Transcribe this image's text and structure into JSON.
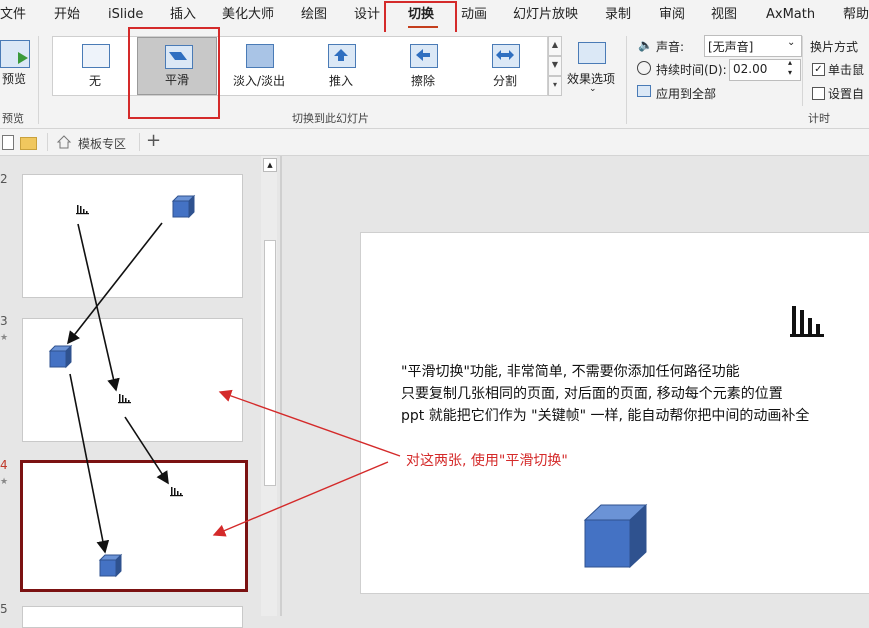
{
  "ribbon_tabs": [
    "文件",
    "开始",
    "iSlide",
    "插入",
    "美化大师",
    "绘图",
    "设计",
    "切换",
    "动画",
    "幻灯片放映",
    "录制",
    "审阅",
    "视图",
    "AxMath",
    "帮助"
  ],
  "active_tab": "切换",
  "preview": {
    "label": "预览",
    "group": "预览"
  },
  "transitions": [
    "无",
    "平滑",
    "淡入/淡出",
    "推入",
    "擦除",
    "分割"
  ],
  "selected_transition": "平滑",
  "effect_options": "效果选项",
  "group_label": "切换到此幻灯片",
  "timing": {
    "sound_label": "声音:",
    "sound_value": "[无声音]",
    "duration_label": "持续时间(D):",
    "duration_value": "02.00",
    "apply_all": "应用到全部",
    "advance_label": "换片方式",
    "on_click": "单击鼠",
    "after": "设置自",
    "group": "计时"
  },
  "file_tab": "模板专区",
  "slide_numbers": [
    "2",
    "3",
    "4",
    "5"
  ],
  "slide_text": [
    "\"平滑切换\"功能, 非常简单, 不需要你添加任何路径功能",
    "只要复制几张相同的页面, 对后面的页面, 移动每个元素的位置",
    "ppt 就能把它们作为 \"关键帧\" 一样, 能自动帮你把中间的动画补全"
  ],
  "annotation": "对这两张, 使用\"平滑切换\"",
  "colors": {
    "accent": "#c00000",
    "cube": "#4472c4",
    "selected_thumb": "#7b1212"
  }
}
